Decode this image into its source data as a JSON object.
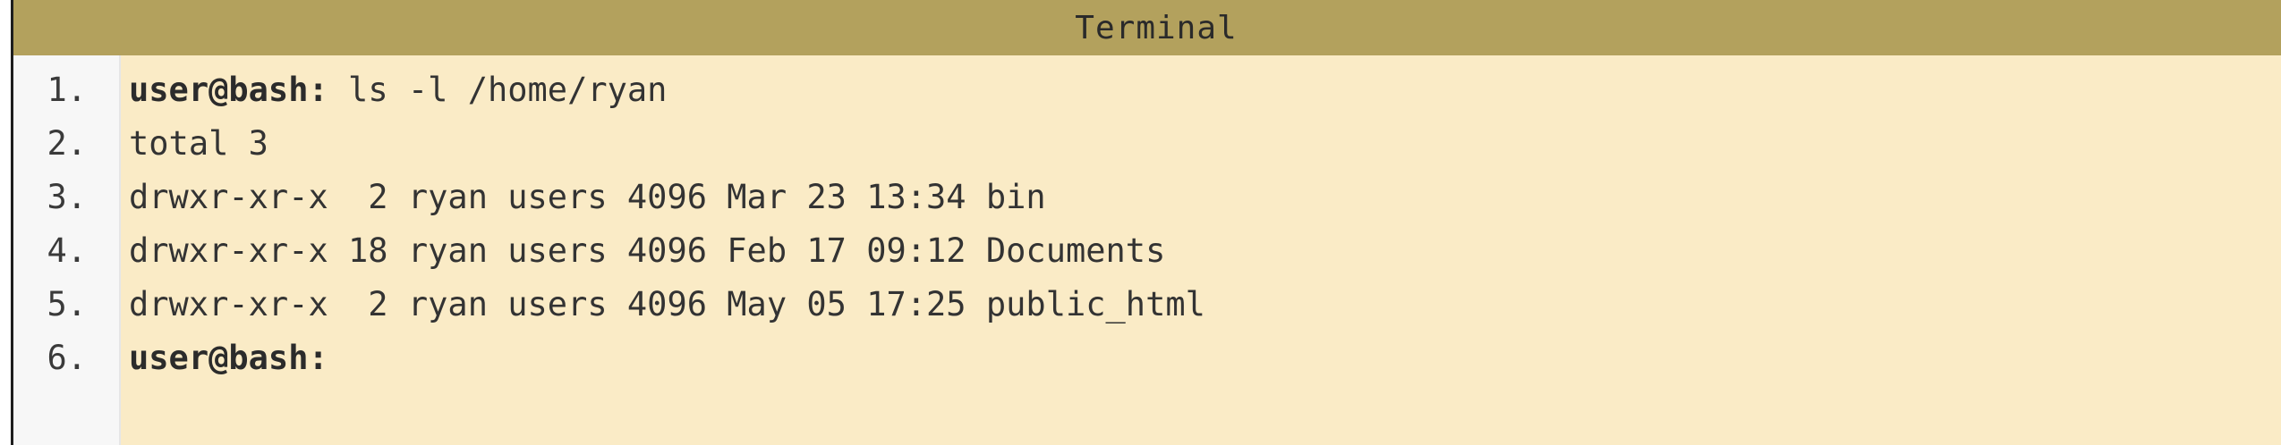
{
  "window": {
    "title": "Terminal",
    "colors": {
      "titlebar": "#b3a15d",
      "background": "#faebc6",
      "gutter": "#f7f7f7",
      "text": "#333333"
    }
  },
  "lines": [
    {
      "number": "1.",
      "prompt": "user@bash:",
      "text": " ls -l /home/ryan"
    },
    {
      "number": "2.",
      "prompt": "",
      "text": "total 3"
    },
    {
      "number": "3.",
      "prompt": "",
      "text": "drwxr-xr-x  2 ryan users 4096 Mar 23 13:34 bin"
    },
    {
      "number": "4.",
      "prompt": "",
      "text": "drwxr-xr-x 18 ryan users 4096 Feb 17 09:12 Documents"
    },
    {
      "number": "5.",
      "prompt": "",
      "text": "drwxr-xr-x  2 ryan users 4096 May 05 17:25 public_html"
    },
    {
      "number": "6.",
      "prompt": "user@bash:",
      "text": ""
    }
  ]
}
